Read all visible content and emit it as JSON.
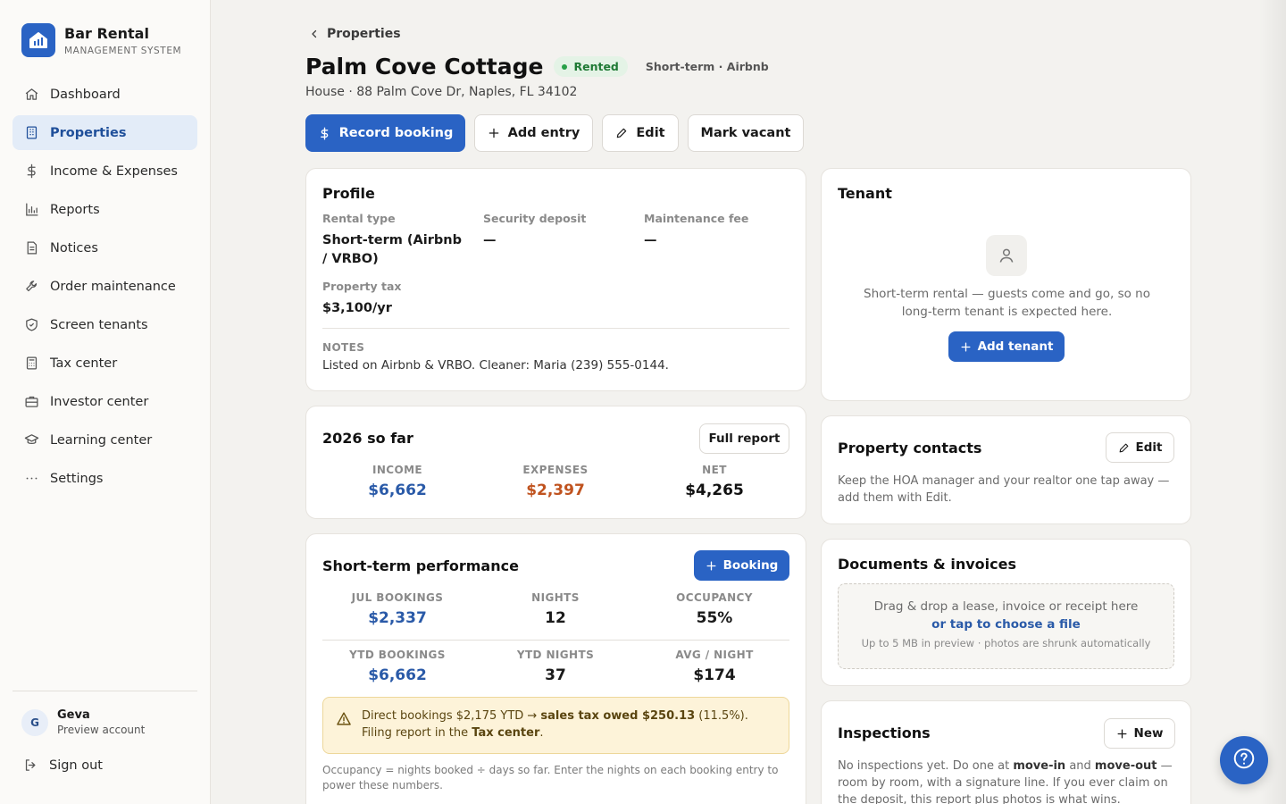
{
  "brand": {
    "name": "Bar Rental",
    "subtitle": "MANAGEMENT SYSTEM"
  },
  "nav": [
    {
      "label": "Dashboard",
      "icon": "home-icon"
    },
    {
      "label": "Properties",
      "icon": "building-icon",
      "active": true
    },
    {
      "label": "Income & Expenses",
      "icon": "dollar-icon"
    },
    {
      "label": "Reports",
      "icon": "bar-chart-icon"
    },
    {
      "label": "Notices",
      "icon": "document-icon"
    },
    {
      "label": "Order maintenance",
      "icon": "wrench-icon"
    },
    {
      "label": "Screen tenants",
      "icon": "shield-icon"
    },
    {
      "label": "Tax center",
      "icon": "calculator-icon"
    },
    {
      "label": "Investor center",
      "icon": "briefcase-icon"
    },
    {
      "label": "Learning center",
      "icon": "graduation-cap-icon"
    },
    {
      "label": "Settings",
      "icon": "more-horizontal-icon"
    }
  ],
  "user": {
    "initial": "G",
    "name": "Geva",
    "subtitle": "Preview account"
  },
  "signout": "Sign out",
  "breadcrumb": "Properties",
  "property": {
    "title": "Palm Cove Cottage",
    "status": "Rented",
    "type_tag": "Short-term · Airbnb",
    "address": "House · 88 Palm Cove Dr, Naples, FL 34102"
  },
  "actions": {
    "record_booking": "Record booking",
    "add_entry": "Add entry",
    "edit": "Edit",
    "mark_vacant": "Mark vacant"
  },
  "profile": {
    "title": "Profile",
    "rental_type_label": "Rental type",
    "rental_type_value": "Short-term (Airbnb / VRBO)",
    "security_deposit_label": "Security deposit",
    "security_deposit_value": "—",
    "maintenance_fee_label": "Maintenance fee",
    "maintenance_fee_value": "—",
    "property_tax_label": "Property tax",
    "property_tax_value": "$3,100/yr",
    "notes_label": "NOTES",
    "notes_value": "Listed on Airbnb & VRBO. Cleaner: Maria (239) 555-0144."
  },
  "ytd": {
    "title": "2026 so far",
    "full_report": "Full report",
    "income_label": "INCOME",
    "income_value": "$6,662",
    "expenses_label": "EXPENSES",
    "expenses_value": "$2,397",
    "net_label": "NET",
    "net_value": "$4,265"
  },
  "performance": {
    "title": "Short-term performance",
    "booking_button": "Booking",
    "jul_bookings_label": "JUL BOOKINGS",
    "jul_bookings_value": "$2,337",
    "nights_label": "NIGHTS",
    "nights_value": "12",
    "occupancy_label": "OCCUPANCY",
    "occupancy_value": "55%",
    "ytd_bookings_label": "YTD BOOKINGS",
    "ytd_bookings_value": "$6,662",
    "ytd_nights_label": "YTD NIGHTS",
    "ytd_nights_value": "37",
    "avg_night_label": "AVG / NIGHT",
    "avg_night_value": "$174",
    "alert_part1": "Direct bookings $2,175 YTD → ",
    "alert_bold1": "sales tax owed $250.13",
    "alert_part2": " (11.5%).",
    "alert_part3": "Filing report in the ",
    "alert_bold2": "Tax center",
    "alert_part4": ".",
    "footnote": "Occupancy = nights booked ÷ days so far. Enter the nights on each booking entry to power these numbers."
  },
  "tenant": {
    "title": "Tenant",
    "message": "Short-term rental — guests come and go, so no long-term tenant is expected here.",
    "add_button": "Add tenant"
  },
  "contacts": {
    "title": "Property contacts",
    "edit_button": "Edit",
    "message": "Keep the HOA manager and your realtor one tap away — add them with Edit."
  },
  "documents": {
    "title": "Documents & invoices",
    "drop_text": "Drag & drop a lease, invoice or receipt here",
    "choose_link": "or tap to choose a file",
    "limit_text": "Up to 5 MB in preview · photos are shrunk automatically"
  },
  "inspections": {
    "title": "Inspections",
    "new_button": "New",
    "text_a": "No inspections yet. Do one at ",
    "bold_a": "move-in",
    "text_b": " and ",
    "bold_b": "move-out",
    "text_c": " — room by room, with a signature line. If you ever claim on the deposit, this report plus photos is what wins."
  },
  "colors": {
    "accent": "#2a63c4",
    "income": "#2a63c4",
    "expense": "#c0531f",
    "rented": "#1f7a35"
  }
}
